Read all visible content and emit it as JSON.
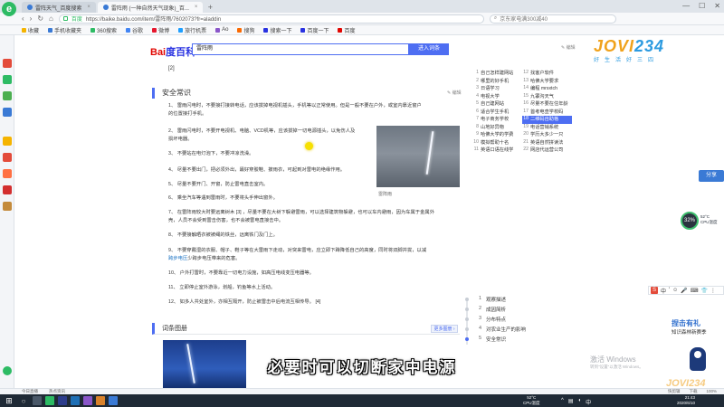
{
  "browser": {
    "app_logo": "e",
    "tabs": [
      {
        "label": "雷阵天气_百度搜索",
        "active": false
      },
      {
        "label": "雷阵雨 (一种自然天气现象)_百...",
        "active": true
      }
    ],
    "new_tab": "+",
    "window_controls": [
      "—",
      "☐",
      "✕"
    ],
    "nav": {
      "back": "‹",
      "forward": "›",
      "refresh": "↻",
      "home": "⌂"
    },
    "url_secure_label": "百度",
    "url": "https://baike.baidu.com/item/雷阵雨/7602073?fr=aladdin",
    "search_placeholder": "京东家电满300减40",
    "bookmarks": [
      "收藏",
      "手机收藏夹",
      "360搜索",
      "谷歌",
      "微博",
      "旅行机票",
      "Ao",
      "搜狗",
      "搜索一下",
      "百度一下",
      "百度"
    ]
  },
  "page": {
    "baidu_logo_a": "Bai",
    "baidu_logo_b": "度",
    "baidu_logo_c": "百科",
    "search_value": "雷阵雨",
    "search_button": "进入词条",
    "edit_mini": "✎ 编辑",
    "brand_logo_a": "JOVI",
    "brand_logo_b": "234",
    "brand_slogan": "好生活好三四",
    "cite_top": "[2]",
    "section_title": "安全常识",
    "section_edit": "✎ 编辑",
    "paragraphs": [
      "1、 雷雨闪电时，不要接打接转电话，应该拔掉电视机插头，手机等以正常使用。但是一般不要在户外，或室内靠近窗户",
      "的位置接打手机。",
      "2、 雷雨闪电时，不要开电视机、电脑、VCD机等，应该拔掉一切电源插头，以免伤人及",
      "损坏电器。",
      "3、 不要站在电灯泡下，不要冲凉洗澡。",
      "4、 尽量不要出门，把必须外出，最好穿胶鞋、披雨衣，可起到对雷电的绝缘作用。",
      "5、 尽量不要开门、开窗，防止雷电直击室内。",
      "6、 乘坐汽车等遇到雷雨时，不要将头手伸出窗外。",
      "7、 在雷阵雨较大时要远离树木 [3] ，尽量不要在大树下躲避雷雨，可以选择建筑物躲避，也可以车内避雨，因为车属于金属外",
      "壳，人员不会受到雷击伤害，也不会被雷电直接击中。",
      "8、 不要接触晒衣被被绳的铁丝，远离铁门及门上。",
      "9、 不要穿戴湿的衣服、帽子、鞋子等在大雷雨下走动，对突来雷电，应立即下蹲降低自己的高度，同时将双脚并拢，以减",
      "少跨步电压带来的危害。",
      "10、 户外打雷时，不要靠近一切电力设施，如高压电线变压电器等。",
      "11、 立即停止室外游泳，划船，钓鱼等水上活动。",
      "12、 如多人共处室外，亦相互隔开，防止被雷击中后电流互相传导。 [4]"
    ],
    "link_text": "跨步电压",
    "pic_caption": "雷阵雨",
    "album_title": "词条图册",
    "album_more": "更多图册 ›",
    "right_list": [
      [
        "1",
        "自己怎样建网站",
        "12",
        "找客户软件"
      ],
      [
        "2",
        "哪里的好手机",
        "13",
        "哈佛大学要求"
      ],
      [
        "3",
        "日语学习",
        "14",
        "编程 mrsxtch"
      ],
      [
        "4",
        "电视大学",
        "15",
        "九寨沟天气"
      ],
      [
        "5",
        "自己建网站",
        "16",
        "尽量不要在住年龄"
      ],
      [
        "6",
        "适合学生手机",
        "17",
        "首考电查学校码"
      ],
      [
        "7",
        "电子商务学校",
        "18",
        "二维码自助格"
      ],
      [
        "8",
        "山地好异物",
        "19",
        "电话营销系统"
      ],
      [
        "9",
        "哈佛大学的学费",
        "20",
        "学历大多少一只"
      ],
      [
        "10",
        "模拟帮助十名",
        "21",
        "英语自然拼读法"
      ],
      [
        "11",
        "英语口语在线学",
        "22",
        "网店代运营公司"
      ]
    ],
    "toc": [
      {
        "num": "1",
        "label": "观察描述"
      },
      {
        "num": "2",
        "label": "成因简析"
      },
      {
        "num": "3",
        "label": "分布特点"
      },
      {
        "num": "4",
        "label": "对农业生产的影响"
      },
      {
        "num": "5",
        "label": "安全常识"
      }
    ]
  },
  "widgets": {
    "share": "分享",
    "speed_value": "32%",
    "speed_line1": "52°C",
    "speed_line2": "CPU温度",
    "ime_label": "中",
    "ime_glyphs": [
      "'",
      "☺",
      "🎤",
      "⌨",
      "👕",
      "⋮"
    ],
    "ad_title": "捏击有礼",
    "ad_sub": "知识森林新赛季",
    "win_activate": "激活 Windows",
    "win_activate_sub": "转到\"设置\"以激活 Windows。"
  },
  "subtitle": "必要时可以切断家中电源",
  "statusbar": {
    "left": [
      "今日直播",
      "热点资讯"
    ],
    "right": [
      "快剪辑",
      "下载",
      "100%"
    ]
  },
  "taskbar": {
    "start": "⊞",
    "search": "○",
    "temp_line1": "52°C",
    "temp_line2": "CPU温度",
    "clock_time": "21:43",
    "clock_date": "2020/6/10"
  },
  "colors": {
    "accent": "#4e6ef2",
    "brand_green": "#2dbb64",
    "link": "#136ec2"
  }
}
